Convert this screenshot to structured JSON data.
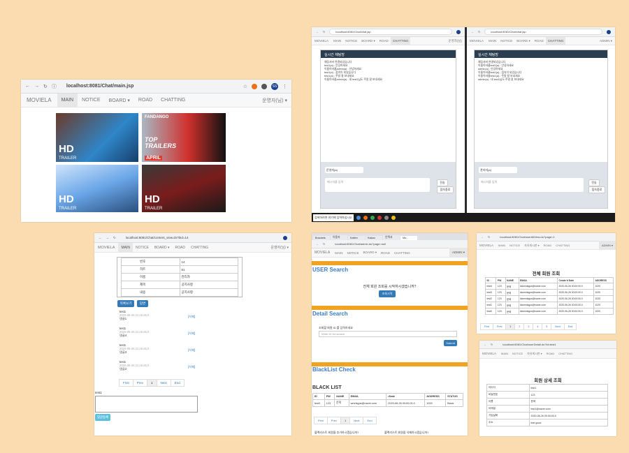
{
  "main": {
    "url": "localhost:8081/Chat/main.jsp",
    "brand": "MOVIELA",
    "nav": [
      "MAIN",
      "NOTICE",
      "BOARD ▾",
      "ROAD",
      "CHATTING"
    ],
    "user": "운영자(님) ▾",
    "avatar": "SS",
    "posters": [
      {
        "badge": "HD",
        "sub": "TRAILER",
        "bg": "#2f86c9"
      },
      {
        "badge": "TOP TRAILERS",
        "sub": "APRIL",
        "top": "FANDANGO",
        "bg": "#d0312d"
      },
      {
        "badge": "HD",
        "sub": "TRAILER",
        "bg": "#6aa6e8"
      },
      {
        "badge": "HD",
        "sub": "TRAILER",
        "bg": "#7a1c1c"
      }
    ]
  },
  "chat": {
    "url": "localhost:8081/Chat/chat.jsp",
    "brand": "MOVIELA",
    "nav": [
      "MAIN",
      "NOTICE",
      "BOARD ▾",
      "ROAD",
      "CHATTING"
    ],
    "left": {
      "user": "운영자(님)",
      "title": "실시간 채팅방",
      "messages": [
        "채팅서버 연결되었습니다",
        "test1(a) : 안녕하세요",
        "이름이바뀜admin(a) : 안녕하세요",
        "test1(a) : 접속이 되었습니다",
        "test1(a) : 주말 잘 보내세요",
        "이름이바뀜admin(a) : 네 test1님도 주말 잘 보내세요"
      ],
      "name_value": "운영자(a)",
      "msg_placeholder": "메시지를 입력",
      "send": "전송",
      "leave": "접속종료"
    },
    "right": {
      "user": "ADMIN ▾",
      "title": "실시간 채팅방",
      "messages": [
        "채팅서버 연결되었습니다",
        "이름이바뀜test1(a) : 안녕하세요",
        "admin(a) : 안녕하세요",
        "이름이바뀜test1(a) : 접속이 되었습니다",
        "이름이바뀜test1(a) : 주말 잘 보내세요",
        "admin(a) : 네 test1님도 주말 잘 보내세요"
      ],
      "name_value": "관리자(a)",
      "msg_placeholder": "메시지를 입력",
      "send": "전송",
      "leave": "접속종료"
    },
    "taskbar_search": "검색하려면 여기에 입력하십시오."
  },
  "board": {
    "url": "localhost:8081/Chat/content_view.do?bId=14",
    "brand": "MOVIELA",
    "nav": [
      "MAIN",
      "NOTICE",
      "BOARD ▾",
      "ROAD",
      "CHATTING"
    ],
    "user": "운영자(님) ▾",
    "rows": [
      [
        "번호",
        "14"
      ],
      [
        "히트",
        "61"
      ],
      [
        "이름",
        "관리자"
      ],
      [
        "제목",
        "공지사항"
      ],
      [
        "내용",
        "공지사항"
      ]
    ],
    "list_btn": "목록보기",
    "reply_btn": "답변",
    "comments": [
      {
        "name": "test1",
        "date": "2020-06-26 21:26:00.0",
        "text": "댓글1",
        "del": "[삭제]"
      },
      {
        "name": "test1",
        "date": "2020-06-26 21:26:00.0",
        "text": "댓글4",
        "del": "[삭제]"
      },
      {
        "name": "test1",
        "date": "2020-06-26 21:26:00.0",
        "text": "댓글3",
        "del": "[삭제]"
      },
      {
        "name": "test1",
        "date": "2020-06-26 21:26:00.0",
        "text": "댓글2",
        "del": "[삭제]"
      }
    ],
    "pager": [
      "First",
      "Prev",
      "1",
      "Next",
      "End"
    ],
    "comment_user": "test1",
    "submit": "댓글등록"
  },
  "admin": {
    "url": "localhost:8081/Chat/admin.do?page=null",
    "tabs": [
      "Brackets",
      "이용자",
      "Kaiten",
      "Kakao",
      "인맥서",
      "Mo..."
    ],
    "brand": "MOVIELA",
    "nav": [
      "MAIN",
      "NOTICE",
      "BOARD ▾",
      "ROAD",
      "CHATTING"
    ],
    "user": "ADMIN ▾",
    "user_search": "USER Search",
    "all_query_text": "전체 회원 조회를 시작하시겠습니까?",
    "all_query_btn": "조회시작",
    "detail_search": "Detail Search",
    "detail_label": "조회할 회원 ID 를 입력하세요",
    "detail_placeholder": "Write ID for search",
    "submit": "Submit",
    "blacklist_check": "BlackList Check",
    "blacklist_title": "BLACK LIST",
    "headers": [
      "ID",
      "PW",
      "NAME",
      "EMAIL",
      "rDate",
      "ADDRESS",
      "STATUS"
    ],
    "row": [
      "test2",
      "123",
      "문혁",
      "wmrlsgus@naver.com",
      "2020-06-26 00:00:00.0",
      "1020",
      "Black"
    ],
    "pager": [
      "First",
      "Prev",
      "1",
      "Next",
      "End"
    ],
    "footer_left": "블랙리스트 회원을 추가하시겠습니까?",
    "footer_right": "블랙리스트 회원을 삭제하시겠습니까?"
  },
  "members": {
    "url": "localhost:8081/Chat/userAllView.do?page=1",
    "brand": "MOVIELA",
    "nav": [
      "MAIN",
      "NOTICE",
      "자유게시판 ▾",
      "ROAD",
      "CHATTING"
    ],
    "user": "ADMIN ▾",
    "title": "전체 회원 조회",
    "headers": [
      "ID",
      "PW",
      "NAME",
      "EMAIL",
      "Create'd Date",
      "ADDRESS"
    ],
    "rows": [
      [
        "test4",
        "123",
        "문혁",
        "kkwmrlsgus@naver.com",
        "2020-06-26 00:00:00.0",
        "1020"
      ],
      [
        "test3",
        "123",
        "문혁",
        "kkwmrlsgus@naver.com",
        "2020-06-26 00:00:00.0",
        "1020"
      ],
      [
        "test2",
        "123",
        "문혁",
        "kkwmrlsgus@naver.com",
        "2020-06-26 00:00:00.0",
        "1020"
      ],
      [
        "test1",
        "123",
        "문혁",
        "kkwmrlsgus@naver.com",
        "2020-06-26 00:00:00.0",
        "1020"
      ],
      [
        "test0",
        "123",
        "문혁",
        "kkwmrlsgus@naver.com",
        "2020-06-26 00:00:00.0",
        "1020"
      ]
    ],
    "pager": [
      "First",
      "Prev",
      "1",
      "2",
      "3",
      "4",
      "5",
      "Next",
      "End"
    ]
  },
  "detail": {
    "url": "localhost:8081/Chat/userDetail.do?id=test1",
    "brand": "MOVIELA",
    "nav": [
      "MAIN",
      "NOTICE",
      "자유게시판 ▾",
      "ROAD",
      "CHATTING"
    ],
    "title": "회원 상세 조회",
    "rows": [
      [
        "아이디",
        "test1"
      ],
      [
        "비밀번호",
        "123"
      ],
      [
        "이름",
        "문혁"
      ],
      [
        "이메일",
        "test1@naver.com"
      ],
      [
        "가입날짜",
        "2020-06-26 00:00:00.0"
      ],
      [
        "주소",
        "test good"
      ]
    ]
  },
  "colors": {
    "page_bg": "#fbdcb0",
    "accent": "#f0a320",
    "blue": "#337ab7",
    "chat_header": "#2b3e50"
  }
}
